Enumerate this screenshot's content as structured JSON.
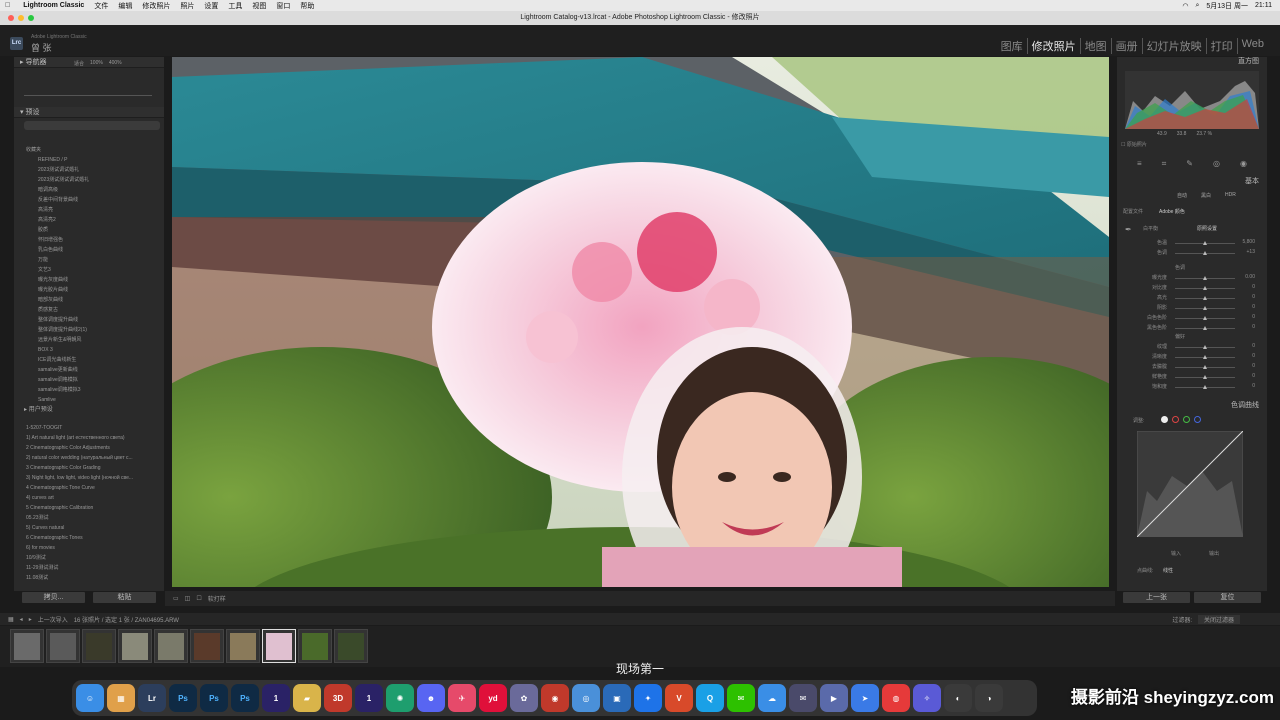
{
  "menubar": {
    "app": "Lightroom Classic",
    "items": [
      "文件",
      "编辑",
      "修改照片",
      "照片",
      "设置",
      "工具",
      "视图",
      "窗口",
      "帮助"
    ],
    "date": "5月13日 周一",
    "time": "21:11"
  },
  "window": {
    "title": "Lightroom Catalog-v13.lrcat - Adobe Photoshop Lightroom Classic - 修改照片"
  },
  "identity": {
    "logo": "Lrc",
    "appname": "Adobe Lightroom Classic",
    "user": "曾 张"
  },
  "modules": [
    "图库",
    "修改照片",
    "地图",
    "画册",
    "幻灯片放映",
    "打印",
    "Web"
  ],
  "left": {
    "navigator": "导航器",
    "nav_fit": "适合",
    "nav_z1": "100%",
    "nav_z2": "400%",
    "presets_title": "预设",
    "presets": [
      "收藏夹",
      "REFINED / P",
      "2023测试调试婚礼",
      "2023测试测试调试婚礼",
      "暗调高级",
      "反差中间背景曲线",
      "高清亮",
      "高清亮2",
      "胶质",
      "怀旧增强色",
      "乳白色曲线",
      "万能",
      "文艺3",
      "曝光灰度曲线",
      "曝光胶片曲线",
      "暗部灰曲线",
      "质感复古",
      "整体调度提升曲线",
      "整体调度提升曲线2(1)",
      "远景片新生&明朝风",
      "BOX 3",
      "ICE调光曲线新生",
      "samalive更新曲线",
      "samalive调格模拟",
      "samalive调格模拟3",
      "Samlive"
    ],
    "user_presets": "用户预设",
    "folders": [
      "1-5207-TOOGIT",
      "1) Art natural light (art естественного света)",
      "2 Cinematographic Color Adjustments",
      "2) natural color wedding (натуральный цвет с...",
      "3 Cinematographic Color Grading",
      "3) Night light, low light, video light (ночной све...",
      "4 Cinematographic Tone Curve",
      "4) curves art",
      "5 Cinematographic Calibration",
      "05.23测试",
      "5) Curves natural",
      "6 Cinematographic Tones",
      "6) for movies",
      "10/9测试",
      "11-29测试测试",
      "11.08测试"
    ],
    "copy": "拷贝...",
    "paste": "粘贴"
  },
  "toolbar": {
    "softproof": "软打样"
  },
  "right": {
    "histogram": "直方图",
    "hist_vals": [
      "43.9",
      "33.8",
      "23.7 %"
    ],
    "original": "原始照片",
    "basic": "基本",
    "auto": "自动",
    "bw": "黑白",
    "hdr": "HDR",
    "profile_label": "配置文件",
    "profile_value": "Adobe 颜色",
    "wb_label": "白平衡",
    "wb_value": "原照设置",
    "sliders_wb": [
      {
        "lab": "色温",
        "val": "5,800"
      },
      {
        "lab": "色调",
        "val": "+13"
      }
    ],
    "tone": "色调",
    "sliders_tone": [
      {
        "lab": "曝光度",
        "val": "0.00"
      },
      {
        "lab": "对比度",
        "val": "0"
      },
      {
        "lab": "高光",
        "val": "0"
      },
      {
        "lab": "阴影",
        "val": "0"
      },
      {
        "lab": "白色色阶",
        "val": "0"
      },
      {
        "lab": "黑色色阶",
        "val": "0"
      }
    ],
    "presence": "偏好",
    "sliders_presence": [
      {
        "lab": "纹理",
        "val": "0"
      },
      {
        "lab": "清晰度",
        "val": "0"
      },
      {
        "lab": "去朦胧",
        "val": "0"
      },
      {
        "lab": "鲜艳度",
        "val": "0"
      },
      {
        "lab": "饱和度",
        "val": "0"
      }
    ],
    "curve": "色调曲线",
    "curve_channel": "调整:",
    "curve_input": "输入",
    "curve_output": "输出",
    "point_curve_label": "点曲线:",
    "point_curve_value": "线性",
    "prev": "上一张",
    "reset": "复位"
  },
  "filmstrip": {
    "source": "上一次导入",
    "count": "16 张照片 / 选定 1 张 / ZAN04695.ARW",
    "filter_label": "过滤器:",
    "filter_value": "关闭过滤器"
  },
  "subtitle": "现场第一",
  "watermark": "摄影前沿 sheyingzyz.com",
  "colors": {
    "accent": "#e8e8e8",
    "panel": "#2a2a2a"
  }
}
